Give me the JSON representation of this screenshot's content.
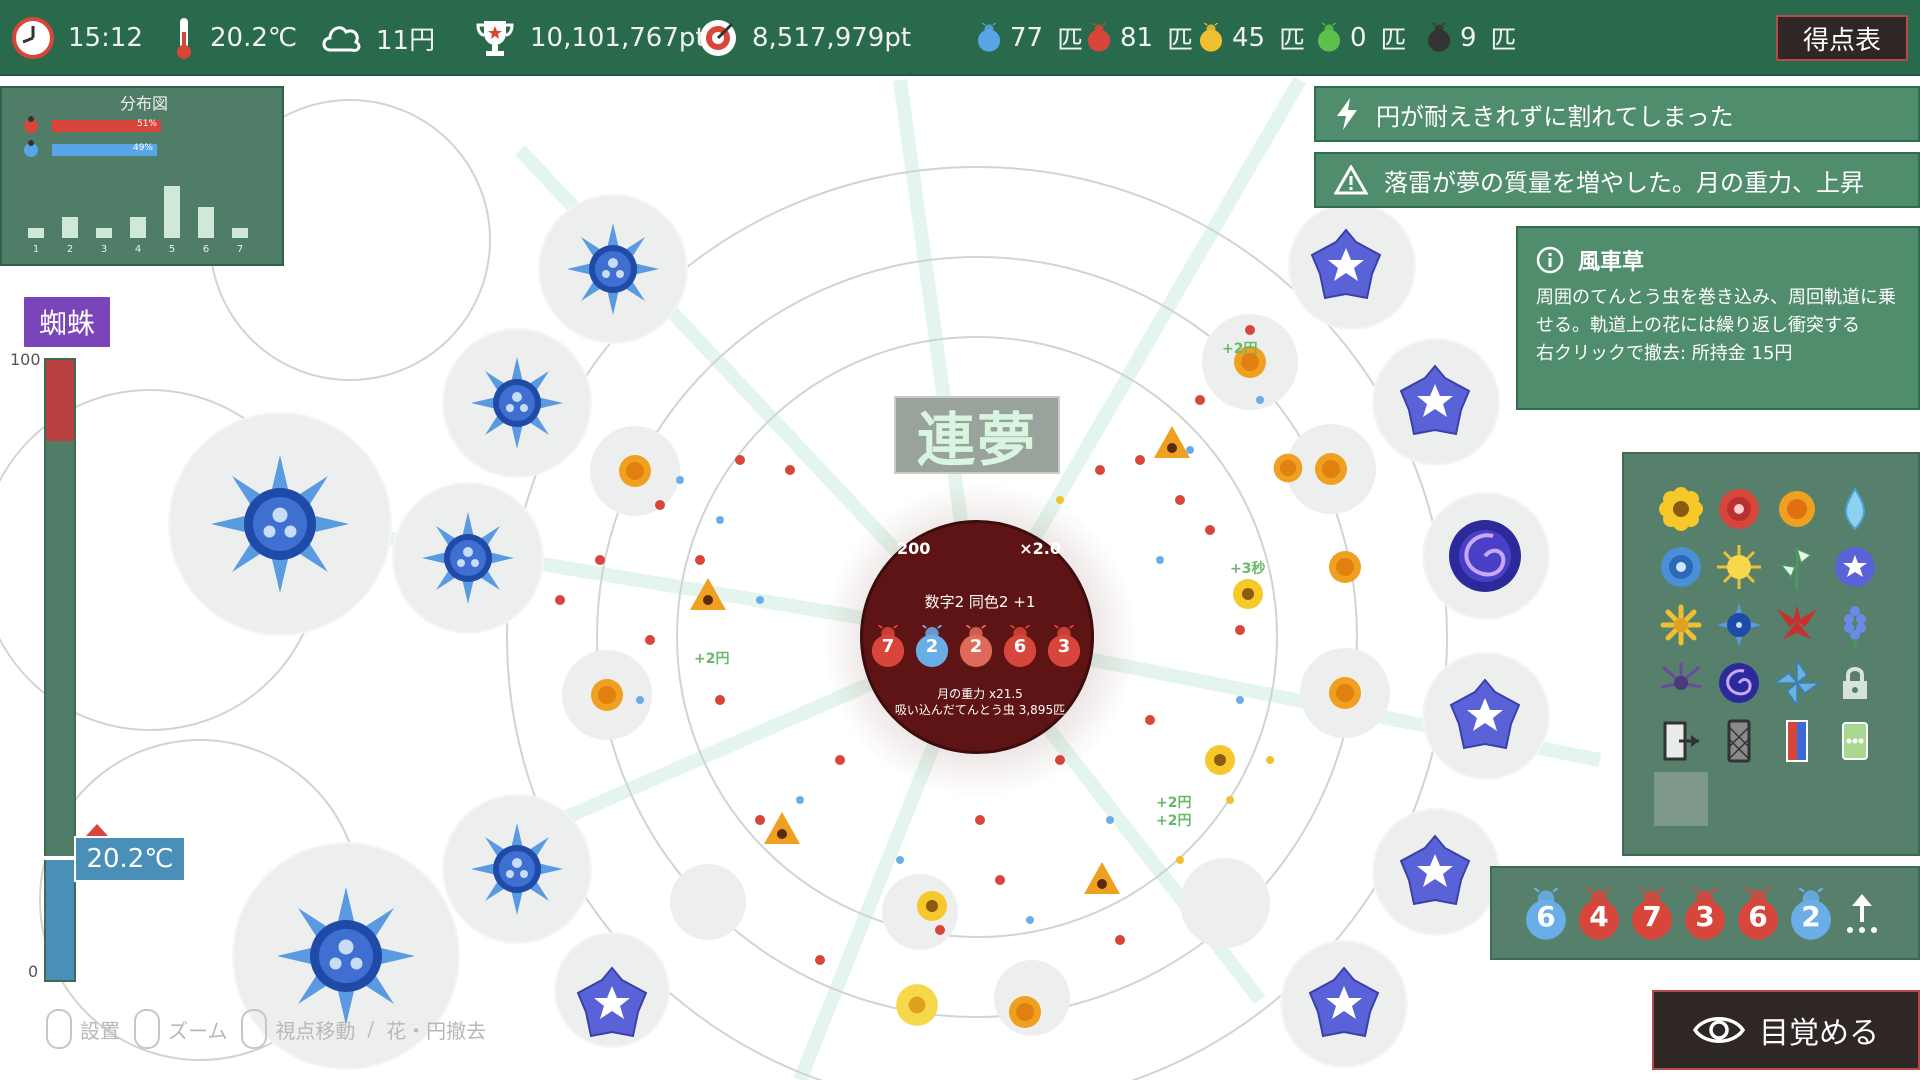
{
  "hud": {
    "time": "15:12",
    "temperature": "20.2℃",
    "money": "11円",
    "high_score": "10,101,767pt",
    "score": "8,517,979pt",
    "bugs": [
      {
        "count": "77",
        "unit": "匹",
        "color": "#58a6e8",
        "name": "blue-ladybug"
      },
      {
        "count": "81",
        "unit": "匹",
        "color": "#d8453a",
        "name": "red-ladybug"
      },
      {
        "count": "45",
        "unit": "匹",
        "color": "#f0c030",
        "name": "yellow-ladybug"
      },
      {
        "count": "0",
        "unit": "匹",
        "color": "#5cc04a",
        "name": "green-ladybug"
      },
      {
        "count": "9",
        "unit": "匹",
        "color": "#333333",
        "name": "black-ladybug"
      }
    ],
    "score_table_label": "得点表"
  },
  "distribution": {
    "title": "分布図",
    "red_percent": "51%",
    "blue_percent": "49%",
    "red_fraction": 0.51,
    "blue_fraction": 0.49,
    "bins": [
      "1",
      "2",
      "3",
      "4",
      "5",
      "6",
      "7"
    ],
    "values": [
      1,
      2,
      1,
      2,
      5,
      3,
      1
    ]
  },
  "gauge": {
    "label": "蜘蛛",
    "max": "100",
    "min": "0",
    "temperature": "20.2℃",
    "red_fraction": 0.13
  },
  "notices": [
    {
      "icon": "lightning-icon",
      "text": "円が耐えきれずに割れてしまった"
    },
    {
      "icon": "warning-icon",
      "text": "落雷が夢の質量を増やした。月の重力、上昇"
    }
  ],
  "info": {
    "title": "風車草",
    "description": "周囲のてんとう虫を巻き込み、周回軌道に乗せる。軌道上の花には繰り返し衝突する",
    "remove_hint": "右クリックで撤去: 所持金 15円"
  },
  "combo_banner": "連夢",
  "moon": {
    "top_left": "200",
    "top_right": "×2.0",
    "combo": "数字2 同色2 +1",
    "bugs": [
      {
        "n": "7",
        "color": "#d8453a"
      },
      {
        "n": "2",
        "color": "#6aaee8"
      },
      {
        "n": "2",
        "color": "#e06a5a"
      },
      {
        "n": "6",
        "color": "#d8453a"
      },
      {
        "n": "3",
        "color": "#d8453a"
      }
    ],
    "gravity": "月の重力 x21.5",
    "absorbed": "吸い込んだてんとう虫 3,895匹"
  },
  "palette": {
    "slots": [
      "sunflower-icon",
      "red-rose-icon",
      "orange-marigold-icon",
      "water-drop-icon",
      "blue-rose-icon",
      "sun-icon",
      "windmill-grass-icon",
      "blue-star-flower-icon",
      "yellow-chrysanthemum-icon",
      "blue-orb-icon",
      "red-lily-icon",
      "blue-hyacinth-icon",
      "purple-thistle-icon",
      "galaxy-rose-icon",
      "pinwheel-icon",
      "lock-icon",
      "exit-door-icon",
      "mesh-card-icon",
      "red-blue-card-icon",
      "more-card-icon"
    ]
  },
  "queue": [
    {
      "n": "6",
      "color": "#6aaee8"
    },
    {
      "n": "4",
      "color": "#d8453a"
    },
    {
      "n": "7",
      "color": "#d8453a"
    },
    {
      "n": "3",
      "color": "#d8453a"
    },
    {
      "n": "6",
      "color": "#d8453a"
    },
    {
      "n": "2",
      "color": "#6aaee8"
    }
  ],
  "wake_label": "目覚める",
  "controls": {
    "place": "設置",
    "zoom": "ズーム",
    "move": "視点移動",
    "remove": "花・円撤去"
  },
  "floating_texts": [
    "+2円",
    "+3秒",
    "+2円",
    "+2円",
    "+2円"
  ]
}
